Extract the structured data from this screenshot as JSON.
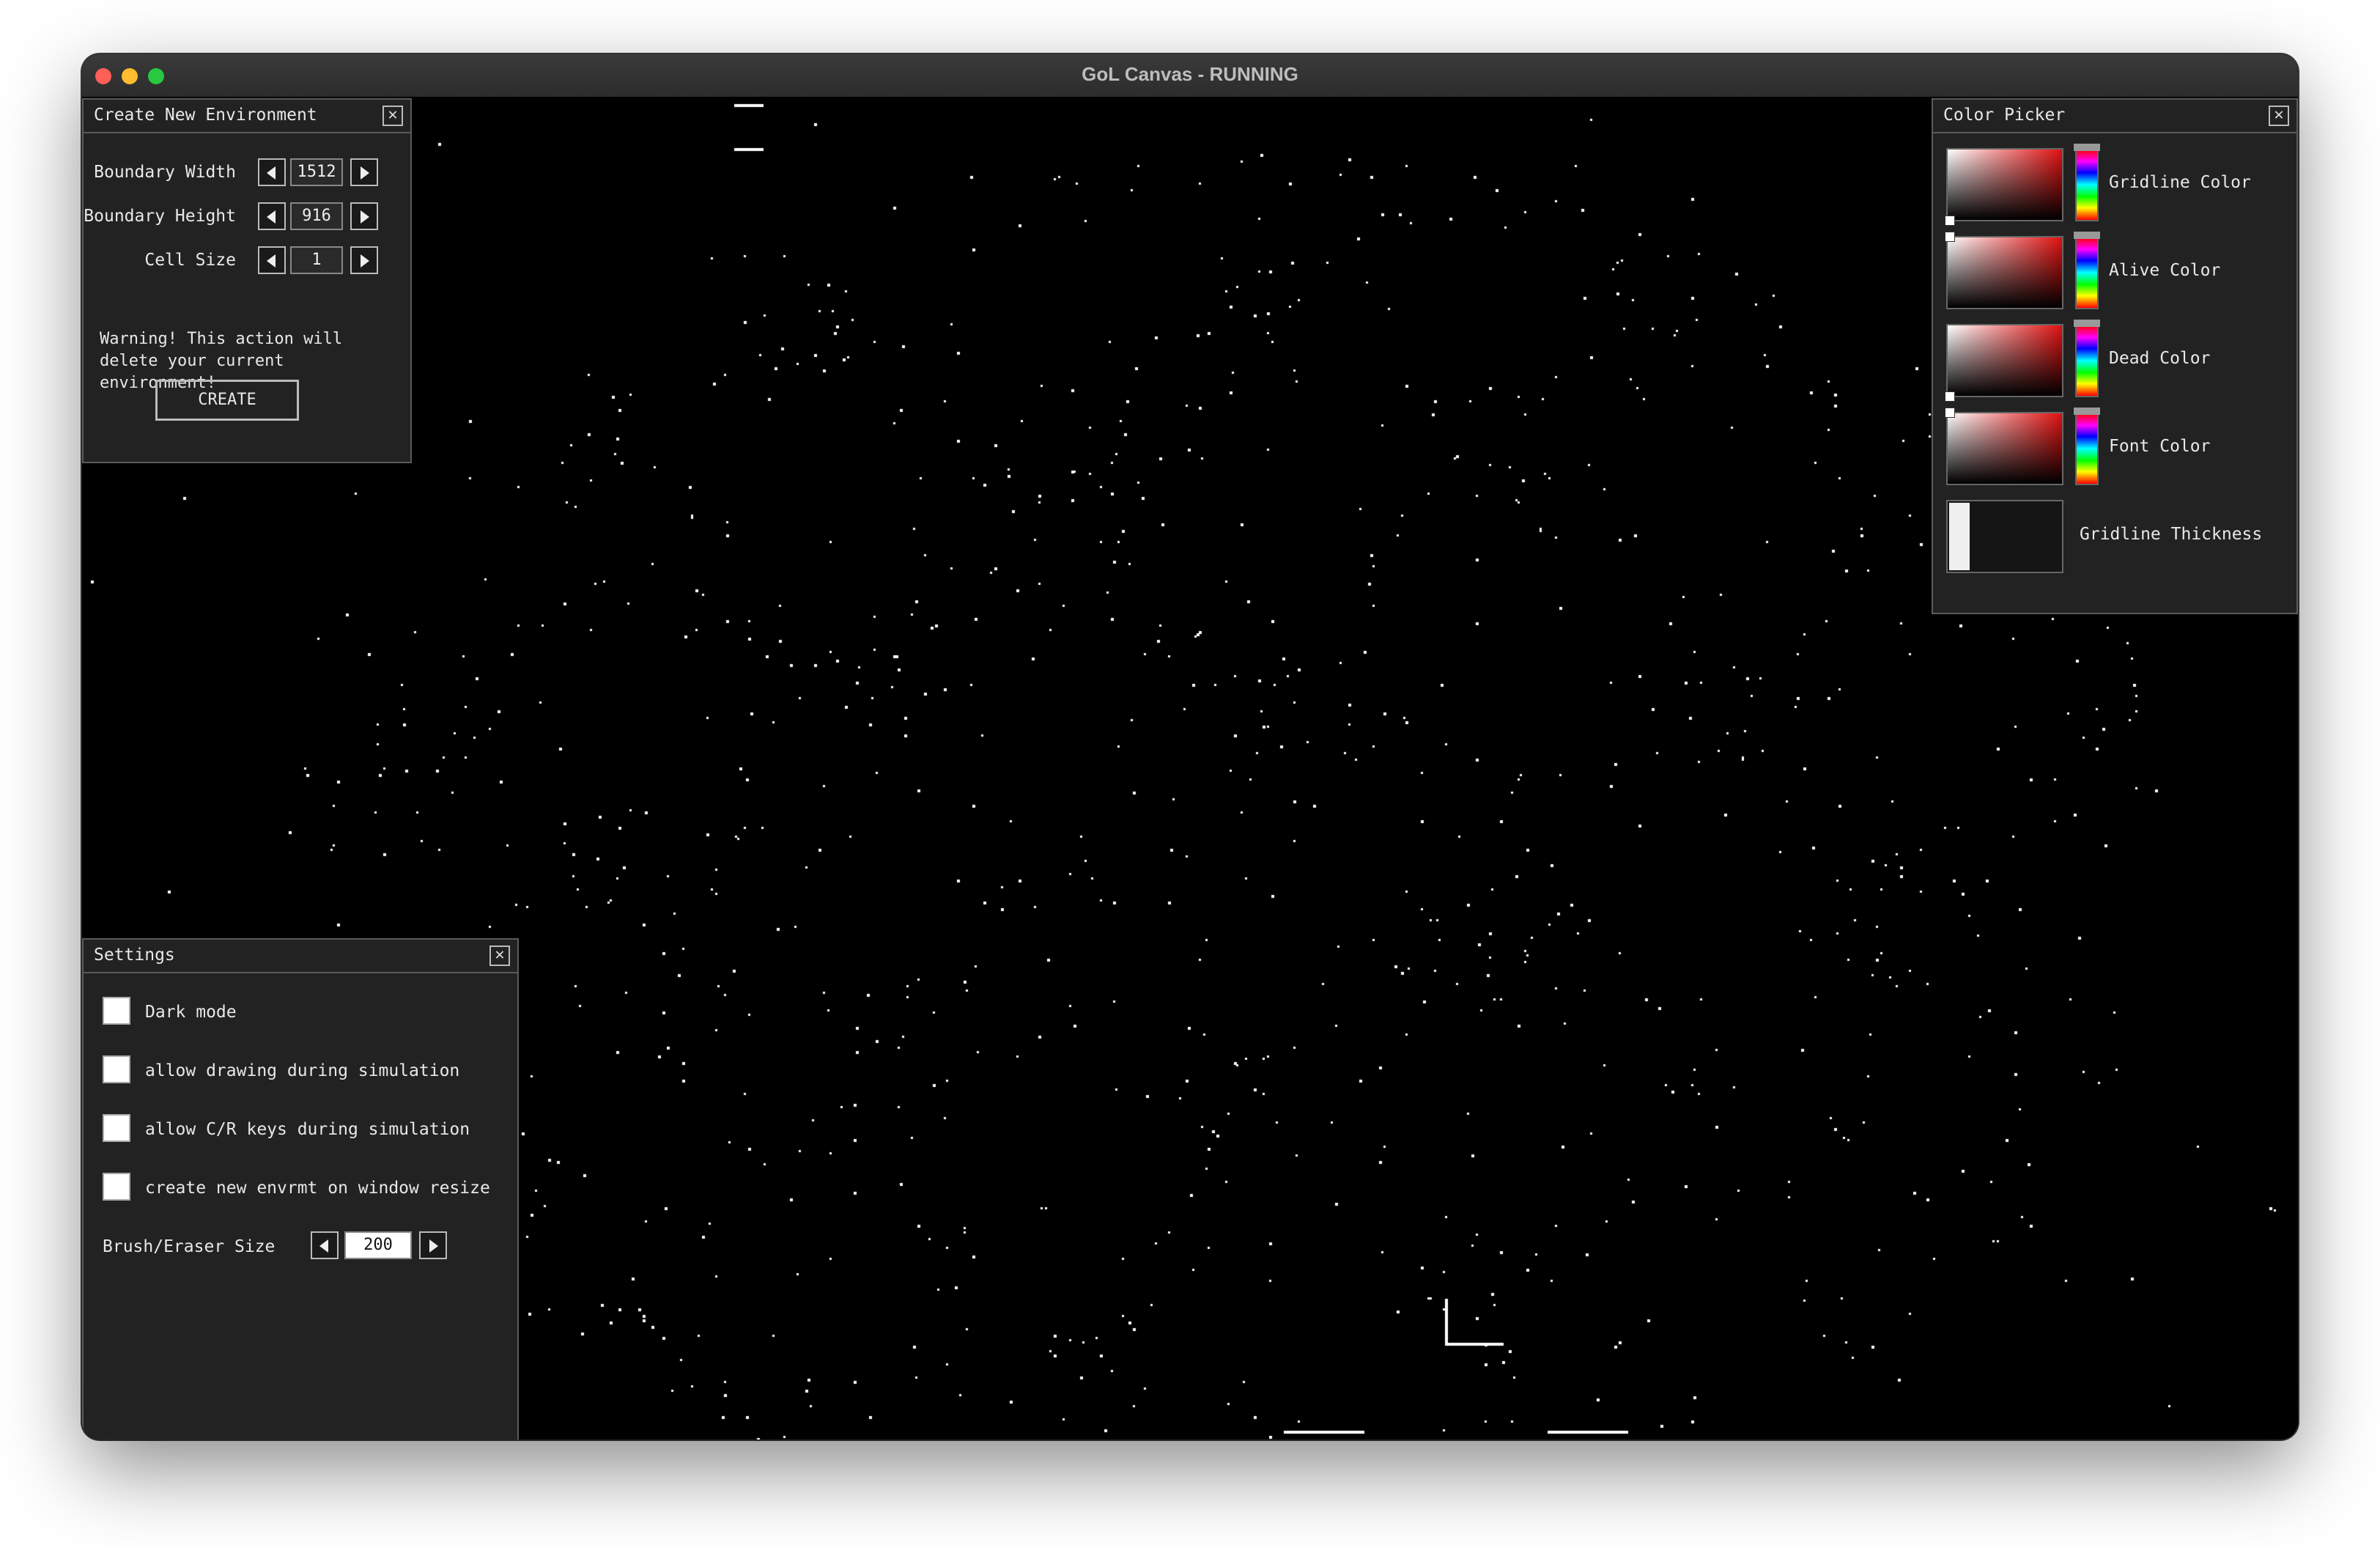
{
  "window": {
    "title": "GoL Canvas - RUNNING"
  },
  "colors": {
    "alive": "#ffffff",
    "dead": "#000000",
    "panel_bg": "#222222",
    "panel_border": "#5a5a5a"
  },
  "create_env": {
    "title": "Create New Environment",
    "close_icon": "✕",
    "fields": [
      {
        "label": "Boundary Width",
        "value": "1512"
      },
      {
        "label": "Boundary Height",
        "value": "916"
      },
      {
        "label": "Cell Size",
        "value": "1"
      }
    ],
    "warning": "Warning! This action will delete your current environment!",
    "create_label": "CREATE"
  },
  "settings": {
    "title": "Settings",
    "close_icon": "✕",
    "options": [
      {
        "label": "Dark mode",
        "checked": false
      },
      {
        "label": "allow drawing during simulation",
        "checked": false
      },
      {
        "label": "allow C/R keys during simulation",
        "checked": false
      },
      {
        "label": "create new envrmt on window resize",
        "checked": false
      }
    ],
    "brush_label": "Brush/Eraser Size",
    "brush_value": "200"
  },
  "color_picker": {
    "title": "Color Picker",
    "close_icon": "✕",
    "items": [
      {
        "label": "Gridline Color"
      },
      {
        "label": "Alive Color"
      },
      {
        "label": "Dead Color"
      },
      {
        "label": "Font Color"
      }
    ],
    "thickness_label": "Gridline Thickness"
  }
}
